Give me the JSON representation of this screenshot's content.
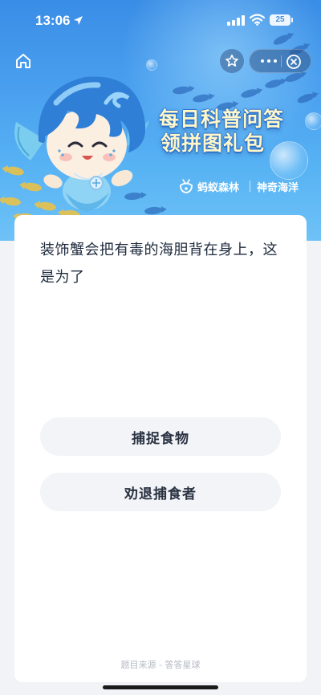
{
  "status_bar": {
    "time": "13:06",
    "battery": "25"
  },
  "banner": {
    "title_line1": "每日科普问答",
    "title_line2": "领拼图礼包",
    "brand_left": "蚂蚁森林",
    "brand_right": "神奇海洋"
  },
  "question": {
    "text": "装饰蟹会把有毒的海胆背在身上，这是为了"
  },
  "options": [
    {
      "label": "捕捉食物"
    },
    {
      "label": "劝退捕食者"
    }
  ],
  "footer": {
    "source": "题目来源 - 答答星球"
  },
  "colors": {
    "banner_top": "#3a8de6",
    "banner_bottom": "#6ec2f6",
    "title_fill": "#fff7c9",
    "option_bg": "#f2f4f7",
    "page_bg": "#f1f3f6"
  }
}
